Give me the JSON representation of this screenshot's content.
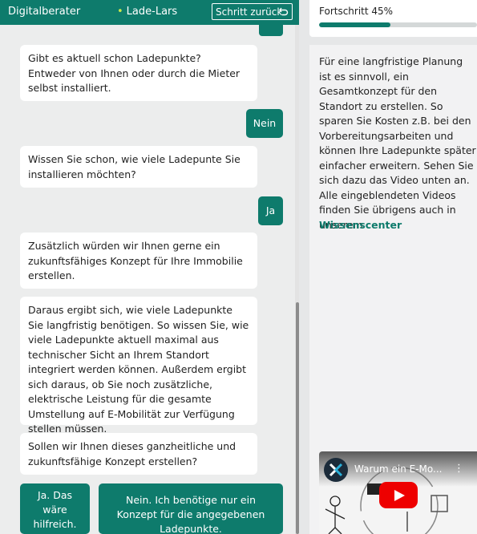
{
  "topbar": {
    "app_label": "Digitalberater",
    "bot_name": "Lade-Lars",
    "back_button": "Schritt zurück",
    "back_icon": "undo-icon"
  },
  "chat": {
    "q1": "Gibt es aktuell schon Ladepunkte? Entweder von Ihnen oder durch die Mieter selbst installiert.",
    "a1": "Nein",
    "q2": "Wissen Sie schon, wie viele Ladepunte Sie installieren möchten?",
    "a2": "Ja",
    "m3": "Zusätzlich würden wir Ihnen gerne ein zukunftsfähiges Konzept für Ihre Immobilie erstellen.",
    "m4": "Daraus ergibt sich, wie viele Ladepunkte Sie langfristig benötigen. So wissen Sie, wie viele Ladepunkte aktuell maximal aus technischer Sicht an Ihrem Standort integriert werden können. Außerdem ergibt sich daraus, ob Sie noch zusätzliche, elektrische Leistung für die gesamte Umstellung auf E-Mobilität zur Verfügung stellen müssen.",
    "q5": "Sollen wir Ihnen dieses ganzheitliche und zukunftsfähige Konzept erstellen?",
    "choice_yes": "Ja. Das wäre hilfreich.",
    "choice_no": "Nein. Ich benötige nur ein Konzept für die angegebenen Ladepunkte."
  },
  "progress": {
    "label": "Fortschritt 45%",
    "value": 0.45
  },
  "info": {
    "text": "Für eine langfristige Planung ist es sinnvoll, ein Gesamtkonzept für den Standort zu erstellen. So sparen Sie Kosten z.B. bei den Vorbereitungsarbeiten und können Ihre Ladepunkte später einfacher erweitern. Sehen Sie sich dazu das Video unten an. Alle eingeblendeten Videos finden Sie übrigens auch in unserem",
    "link": "Wissenscenter"
  },
  "video": {
    "title": "Warum ein E-Mo...",
    "menu_icon": "more-vert-icon",
    "play_icon": "play-icon"
  },
  "colors": {
    "brand": "#0e7b6c",
    "accent_dot": "#c8e84a",
    "play_red": "#ee0000"
  }
}
